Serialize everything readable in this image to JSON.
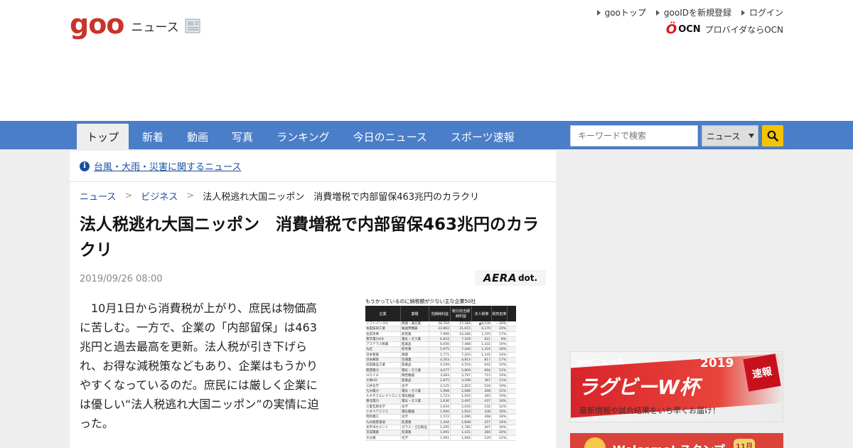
{
  "logo": {
    "brand": "goo",
    "section": "ニュース"
  },
  "top_links": [
    "gooトップ",
    "gooIDを新規登録",
    "ログイン"
  ],
  "ocn": {
    "logo": "OCN",
    "text": "プロバイダならOCN"
  },
  "nav": {
    "tabs": [
      "トップ",
      "新着",
      "動画",
      "写真",
      "ランキング",
      "今日のニュース",
      "スポーツ速報"
    ],
    "active_tab": "トップ"
  },
  "search": {
    "placeholder": "キーワードで検索",
    "category": "ニュース"
  },
  "notice": {
    "text": "台風・大雨・災害に関するニュース"
  },
  "breadcrumb": {
    "items": [
      "ニュース",
      "ビジネス"
    ],
    "separator": ">",
    "current": "法人税逃れ大国ニッポン　消費増税で内部留保463兆円のカラクリ"
  },
  "article": {
    "title": "法人税逃れ大国ニッポン　消費増税で内部留保463兆円のカラクリ",
    "date": "2019/09/26 08:00",
    "source": {
      "name": "AERA",
      "suffix": "dot."
    },
    "body": "　10月1日から消費税が上がり、庶民は物価高に苦しむ。一方で、企業の「内部留保」は463兆円と過去最高を更新。法人税が引き下げられ、お得な減税策などもあり、企業はもうかりやすくなっているのだ。庶民には厳しく企業には優しい“法人税逃れ大国ニッポン”の実情に迫った。"
  },
  "table_image": {
    "caption": "もうかっているのに納税額が少ない主な企業50社",
    "headers": [
      "企業",
      "業種",
      "当期純利益",
      "税引前当期純利益",
      "法人税等",
      "税負担率"
    ],
    "rows": [
      [
        "ソフトバンクG",
        "情報・通信業",
        "38,764",
        "27,384",
        "▲8,236",
        "－30%"
      ],
      [
        "本田技研工業",
        "輸送用機器",
        "22,802",
        "31,015",
        "6,170",
        "20%"
      ],
      [
        "住友商事",
        "卸売業",
        "7,999",
        "10,286",
        "1,705",
        "17%"
      ],
      [
        "東京電力HD",
        "電気・ガス業",
        "6,833",
        "7,329",
        "621",
        "8%"
      ],
      [
        "アステラス製薬",
        "医薬品",
        "6,056",
        "7,488",
        "1,432",
        "19%"
      ],
      [
        "丸紅",
        "卸売業",
        "5,975",
        "7,440",
        "1,324",
        "18%"
      ],
      [
        "日本製鉄",
        "鉄鋼",
        "5,771",
        "7,203",
        "1,145",
        "16%"
      ],
      [
        "日本郵政",
        "空運業",
        "4,503",
        "4,814",
        "817",
        "17%"
      ],
      [
        "武田薬品工業",
        "医薬品",
        "4,109",
        "4,554",
        "642",
        "10%"
      ],
      [
        "関西電力",
        "電気・ガス業",
        "4,077",
        "5,800",
        "694",
        "12%"
      ],
      [
        "ＨＯＹＡ",
        "精密機器",
        "3,083",
        "3,797",
        "715",
        "19%"
      ],
      [
        "大塚HD",
        "医薬品",
        "2,875",
        "3,298",
        "367",
        "11%"
      ],
      [
        "三井化学",
        "化学",
        "2,125",
        "2,852",
        "534",
        "19%"
      ],
      [
        "九州電力",
        "電気・ガス業",
        "1,968",
        "2,086",
        "308",
        "15%"
      ],
      [
        "ルネサスエレクトロニクス",
        "電気機器",
        "1,723",
        "1,935",
        "365",
        "19%"
      ],
      [
        "東北電力",
        "電気・ガス業",
        "1,636",
        "2,497",
        "437",
        "18%"
      ],
      [
        "三菱瓦斯化学",
        "化学",
        "1,634",
        "2,035",
        "232",
        "12%"
      ],
      [
        "ミネベアミツミ",
        "電気機器",
        "1,606",
        "1,910",
        "338",
        "18%"
      ],
      [
        "昭和電工",
        "化学",
        "1,572",
        "2,096",
        "368",
        "18%"
      ],
      [
        "九州旅客鉄道",
        "陸運業",
        "1,444",
        "1,848",
        "257",
        "14%"
      ],
      [
        "太平洋セメント",
        "ガラス・土石製品",
        "1,295",
        "1,785",
        "307",
        "18%"
      ],
      [
        "京成電鉄",
        "陸運業",
        "1,091",
        "1,431",
        "284",
        "20%"
      ],
      [
        "大分銀",
        "化学",
        "1,061",
        "1,081",
        "129",
        "12%"
      ]
    ]
  },
  "ads": {
    "rugby": {
      "badge": "gooニュース",
      "year": "2019",
      "title": "ラグビーW杯",
      "subtitle": "最新情報や試合結果をいち早くお届け！",
      "flash": "速報"
    },
    "stamp": {
      "text": "Welcome! スタンプ",
      "badge": "11月"
    }
  },
  "colors": {
    "brand_red": "#c8332b",
    "nav_blue": "#4a7ec8",
    "link_blue": "#1a4fa0",
    "search_button": "#f5c400"
  }
}
